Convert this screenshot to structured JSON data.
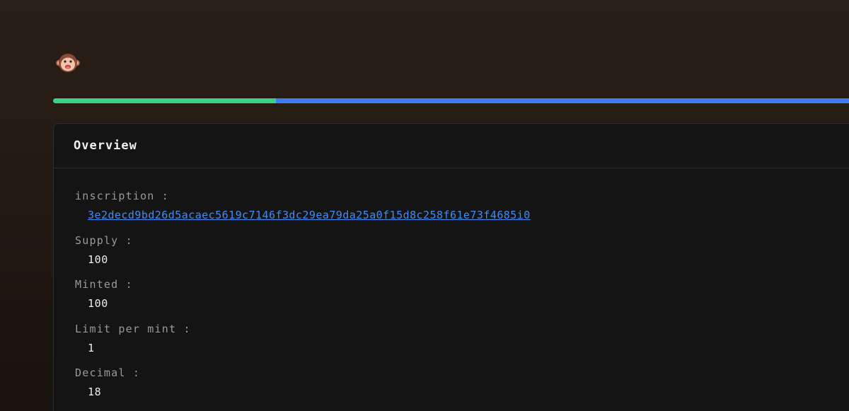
{
  "avatar": {
    "icon": "monkey-face-icon"
  },
  "progress": {
    "value_percent": 28,
    "fill_color": "#3ccf86",
    "track_color": "#3d7ff2"
  },
  "card": {
    "title": "Overview",
    "fields": [
      {
        "label": "inscription :",
        "value": "3e2decd9bd26d5acaec5619c7146f3dc29ea79da25a0f15d8c258f61e73f4685i0"
      },
      {
        "label": "Supply :",
        "value": "100"
      },
      {
        "label": "Minted :",
        "value": "100"
      },
      {
        "label": "Limit per mint :",
        "value": "1"
      },
      {
        "label": "Decimal :",
        "value": "18"
      }
    ]
  }
}
